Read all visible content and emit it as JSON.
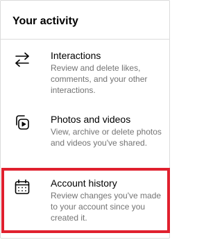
{
  "header": {
    "title": "Your activity"
  },
  "items": [
    {
      "icon": "interactions-arrows-icon",
      "title": "Interactions",
      "description": "Review and delete likes, comments, and your other interactions."
    },
    {
      "icon": "photos-videos-icon",
      "title": "Photos and videos",
      "description": "View, archive or delete photos and videos you've shared."
    },
    {
      "icon": "calendar-icon",
      "title": "Account history",
      "description": "Review changes you've made to your account since you created it."
    }
  ],
  "colors": {
    "highlight_border": "#e0202e",
    "secondary_text": "#737373",
    "divider": "#dbdbdb"
  }
}
